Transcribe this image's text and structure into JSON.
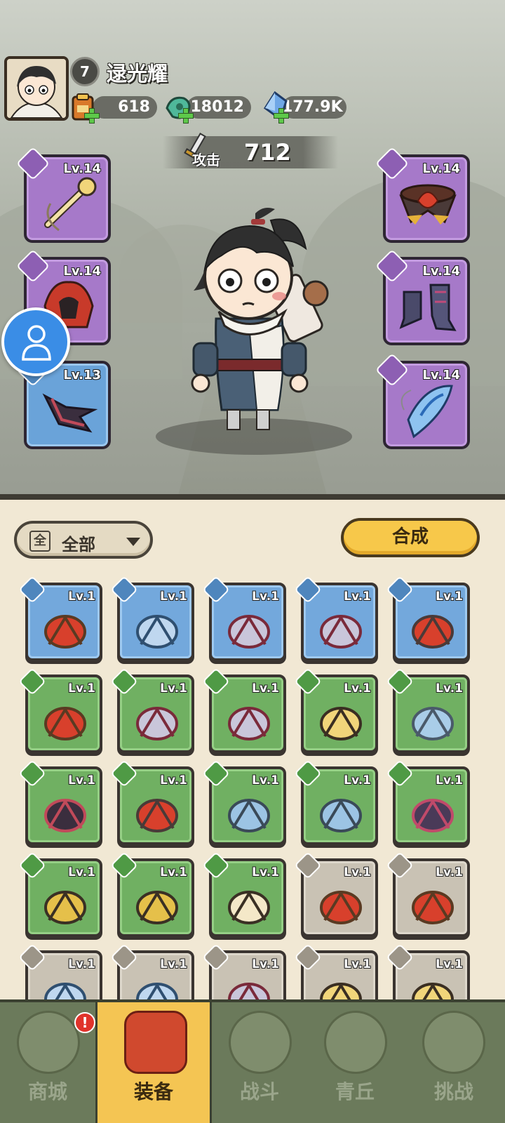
{
  "player": {
    "level": "7",
    "name": "逯光耀"
  },
  "resources": {
    "scroll": "618",
    "jade": "18012",
    "crystal": "177.9K"
  },
  "attack": {
    "label": "攻击",
    "value": "712"
  },
  "equipped": {
    "left": [
      {
        "level": "Lv.14",
        "rarity": "purple",
        "icon": "golden-scepter-icon"
      },
      {
        "level": "Lv.14",
        "rarity": "purple",
        "icon": "red-helmet-icon"
      },
      {
        "level": "Lv.13",
        "rarity": "blue",
        "icon": "dark-claw-bracer-icon"
      }
    ],
    "right": [
      {
        "level": "Lv.14",
        "rarity": "purple",
        "icon": "lotus-belt-icon"
      },
      {
        "level": "Lv.14",
        "rarity": "purple",
        "icon": "armored-boots-icon"
      },
      {
        "level": "Lv.14",
        "rarity": "purple",
        "icon": "crystal-pendant-icon"
      }
    ]
  },
  "inventory": {
    "filter_label": "全部",
    "filter_icon_text": "全",
    "merge_label": "合成",
    "items": [
      {
        "level": "Lv.1",
        "rarity": "blue",
        "icon": "flame-staff-icon"
      },
      {
        "level": "Lv.1",
        "rarity": "blue",
        "icon": "ice-bow-icon"
      },
      {
        "level": "Lv.1",
        "rarity": "blue",
        "icon": "hammer-icon"
      },
      {
        "level": "Lv.1",
        "rarity": "blue",
        "icon": "hammer-icon"
      },
      {
        "level": "Lv.1",
        "rarity": "blue",
        "icon": "lotus-belt-icon"
      },
      {
        "level": "Lv.1",
        "rarity": "green",
        "icon": "flame-staff-icon"
      },
      {
        "level": "Lv.1",
        "rarity": "green",
        "icon": "hammer-icon"
      },
      {
        "level": "Lv.1",
        "rarity": "green",
        "icon": "hammer-icon"
      },
      {
        "level": "Lv.1",
        "rarity": "green",
        "icon": "golden-scepter-icon"
      },
      {
        "level": "Lv.1",
        "rarity": "green",
        "icon": "ice-armor-icon"
      },
      {
        "level": "Lv.1",
        "rarity": "green",
        "icon": "dark-claw-bracer-icon"
      },
      {
        "level": "Lv.1",
        "rarity": "green",
        "icon": "lotus-belt-icon"
      },
      {
        "level": "Lv.1",
        "rarity": "green",
        "icon": "ice-belt-icon"
      },
      {
        "level": "Lv.1",
        "rarity": "green",
        "icon": "ice-belt-icon"
      },
      {
        "level": "Lv.1",
        "rarity": "green",
        "icon": "dark-belt-icon"
      },
      {
        "level": "Lv.1",
        "rarity": "green",
        "icon": "golden-belt-icon"
      },
      {
        "level": "Lv.1",
        "rarity": "green",
        "icon": "golden-belt-icon"
      },
      {
        "level": "Lv.1",
        "rarity": "green",
        "icon": "fang-necklace-icon"
      },
      {
        "level": "Lv.1",
        "rarity": "white",
        "icon": "flame-staff-icon"
      },
      {
        "level": "Lv.1",
        "rarity": "white",
        "icon": "flame-staff-icon"
      },
      {
        "level": "Lv.1",
        "rarity": "white",
        "icon": "ice-bow-icon"
      },
      {
        "level": "Lv.1",
        "rarity": "white",
        "icon": "ice-bow-icon"
      },
      {
        "level": "Lv.1",
        "rarity": "white",
        "icon": "hammer-icon"
      },
      {
        "level": "Lv.1",
        "rarity": "white",
        "icon": "golden-scepter-icon"
      },
      {
        "level": "Lv.1",
        "rarity": "white",
        "icon": "golden-scepter-icon"
      }
    ]
  },
  "nav": {
    "tabs": [
      {
        "label": "商城",
        "icon": "shop-icon"
      },
      {
        "label": "装备",
        "icon": "helmet-icon"
      },
      {
        "label": "战斗",
        "icon": "crossed-swords-icon"
      },
      {
        "label": "青丘",
        "icon": "mountain-icon"
      },
      {
        "label": "挑战",
        "icon": "challenge-icon"
      }
    ],
    "notice": "!"
  },
  "colors": {
    "purple": "#a679c9",
    "blue": "#73a8dc",
    "green": "#70b062",
    "white": "#c9c2b4",
    "accent_yellow": "#f4c553"
  }
}
